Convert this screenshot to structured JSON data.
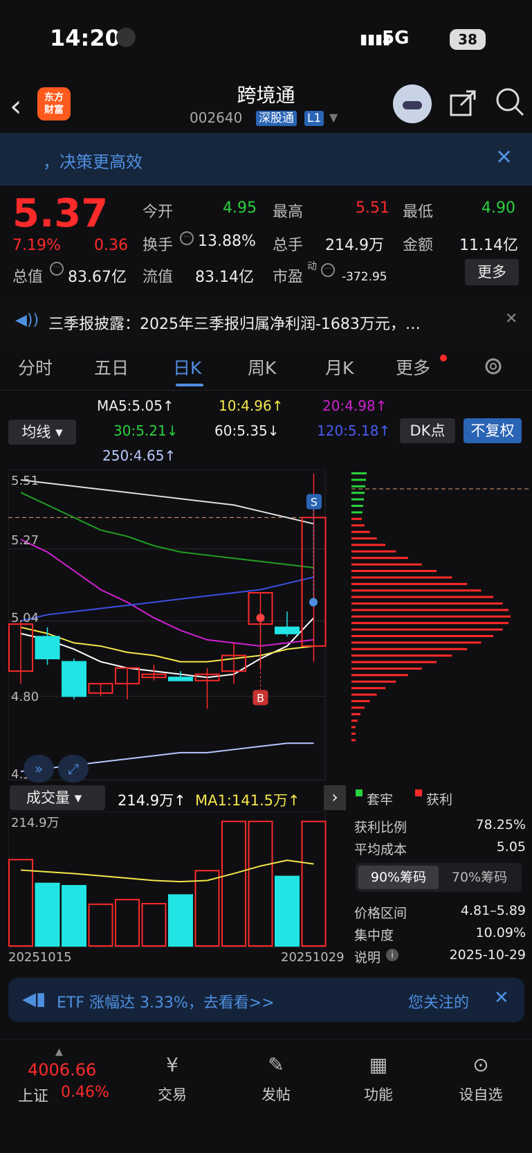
{
  "status": {
    "time": "14:20",
    "network": "5G",
    "battery": "38"
  },
  "header": {
    "logo": "东方\n财富",
    "title": "跨境通",
    "code": "002640",
    "tag1": "深股通",
    "tag2": "L1"
  },
  "banner": {
    "text": "，决策更高效"
  },
  "quote": {
    "price": "5.37",
    "pct": "7.19%",
    "change": "0.36",
    "open_label": "今开",
    "open": "4.95",
    "high_label": "最高",
    "high": "5.51",
    "low_label": "最低",
    "low": "4.90",
    "turnover_label": "换手",
    "turnover": "13.88%",
    "volume_label": "总手",
    "volume": "214.9万",
    "amount_label": "金额",
    "amount": "11.14亿",
    "mktcap_label": "总值",
    "mktcap": "83.67亿",
    "float_label": "流值",
    "float": "83.14亿",
    "pe_label": "市盈",
    "pe_sup": "动",
    "pe": "-372.95",
    "more": "更多"
  },
  "notice": {
    "text": "三季报披露：2025年三季报归属净利润-1683万元，…"
  },
  "tabs": [
    "分时",
    "五日",
    "日K",
    "周K",
    "月K",
    "更多"
  ],
  "ma_legend": {
    "ma5": "MA5:5.05↑",
    "ma10": "10:4.96↑",
    "ma20": "20:4.98↑",
    "ma30": "30:5.21↓",
    "ma60": "60:5.35↓",
    "ma120": "120:5.18↑",
    "ma250": "250:4.65↑",
    "selector": "均线",
    "dk": "DK点",
    "fq": "不复权"
  },
  "price_axis": [
    "5.51",
    "5.27",
    "5.04",
    "4.80",
    "4.56"
  ],
  "chart_data": {
    "type": "candlestick",
    "dates": [
      "20251015",
      "20251029"
    ],
    "ylim": [
      4.56,
      5.51
    ],
    "candles": [
      {
        "o": 4.88,
        "h": 5.04,
        "l": 4.84,
        "c": 5.03
      },
      {
        "o": 4.99,
        "h": 5.02,
        "l": 4.9,
        "c": 4.92
      },
      {
        "o": 4.91,
        "h": 4.92,
        "l": 4.79,
        "c": 4.8
      },
      {
        "o": 4.81,
        "h": 4.84,
        "l": 4.8,
        "c": 4.84
      },
      {
        "o": 4.84,
        "h": 4.89,
        "l": 4.79,
        "c": 4.89
      },
      {
        "o": 4.86,
        "h": 4.9,
        "l": 4.85,
        "c": 4.87
      },
      {
        "o": 4.86,
        "h": 4.88,
        "l": 4.85,
        "c": 4.85
      },
      {
        "o": 4.85,
        "h": 4.89,
        "l": 4.76,
        "c": 4.87
      },
      {
        "o": 4.88,
        "h": 4.97,
        "l": 4.84,
        "c": 4.93
      },
      {
        "o": 5.03,
        "h": 5.13,
        "l": 4.89,
        "c": 5.13
      },
      {
        "o": 5.02,
        "h": 5.07,
        "l": 4.99,
        "c": 5.0
      },
      {
        "o": 4.96,
        "h": 5.51,
        "l": 4.91,
        "c": 5.37
      }
    ],
    "ma_lines": [
      {
        "name": "MA5",
        "color": "#ffffff",
        "values": [
          5.0,
          4.98,
          4.95,
          4.91,
          4.89,
          4.88,
          4.87,
          4.86,
          4.87,
          4.92,
          4.96,
          5.05
        ]
      },
      {
        "name": "MA10",
        "color": "#f5e84a",
        "values": [
          5.02,
          5.0,
          4.97,
          4.96,
          4.94,
          4.93,
          4.91,
          4.91,
          4.92,
          4.93,
          4.95,
          4.96
        ]
      },
      {
        "name": "MA20",
        "color": "#d021d0",
        "values": [
          5.3,
          5.26,
          5.2,
          5.14,
          5.1,
          5.05,
          5.01,
          4.98,
          4.97,
          4.96,
          4.97,
          4.98
        ]
      },
      {
        "name": "MA30",
        "color": "#22a022",
        "values": [
          5.45,
          5.41,
          5.37,
          5.33,
          5.31,
          5.28,
          5.26,
          5.25,
          5.24,
          5.23,
          5.22,
          5.21
        ]
      },
      {
        "name": "MA60",
        "color": "#e0e0e0",
        "values": [
          5.49,
          5.48,
          5.47,
          5.46,
          5.45,
          5.44,
          5.43,
          5.42,
          5.41,
          5.39,
          5.37,
          5.35
        ]
      },
      {
        "name": "MA120",
        "color": "#3d4fe0",
        "values": [
          5.04,
          5.06,
          5.07,
          5.08,
          5.09,
          5.1,
          5.11,
          5.12,
          5.13,
          5.14,
          5.16,
          5.18
        ]
      },
      {
        "name": "MA250",
        "color": "#b8c8ff",
        "values": [
          4.56,
          4.57,
          4.58,
          4.59,
          4.6,
          4.61,
          4.62,
          4.62,
          4.63,
          4.64,
          4.65,
          4.65
        ]
      }
    ],
    "signals": [
      {
        "label": "S",
        "index": 10
      },
      {
        "label": "B",
        "index": 9
      }
    ],
    "volume": [
      149,
      108,
      104,
      72,
      80,
      73,
      88,
      130,
      215,
      215,
      120,
      214.9
    ],
    "volume_ma": [
      131,
      128,
      125,
      121,
      117,
      113,
      111,
      113,
      125,
      138,
      148,
      141.5
    ],
    "chips": {
      "profit": 78.25,
      "avg_cost": 5.05
    }
  },
  "volume": {
    "selector": "成交量",
    "value": "214.9万↑",
    "ma1": "MA1:141.5万↑",
    "max": "214.9万",
    "date_start": "20251015",
    "date_end": "20251029"
  },
  "chips": {
    "legend_trap": "套牢",
    "legend_profit": "获利",
    "profit_label": "获利比例",
    "profit": "78.25%",
    "cost_label": "平均成本",
    "cost": "5.05",
    "tab90": "90%筹码",
    "tab70": "70%筹码",
    "range_label": "价格区间",
    "range": "4.81–5.89",
    "conc_label": "集中度",
    "conc": "10.09%",
    "note_label": "说明",
    "note_date": "2025-10-29"
  },
  "etf_banner": {
    "text": "ETF 涨幅达 3.33%，去看看>>",
    "right": "您关注的"
  },
  "bottom": {
    "index_value": "4006.66",
    "index_name": "上证",
    "index_pct": "0.46%",
    "trade": "交易",
    "post": "发帖",
    "func": "功能",
    "watch": "设自选"
  }
}
